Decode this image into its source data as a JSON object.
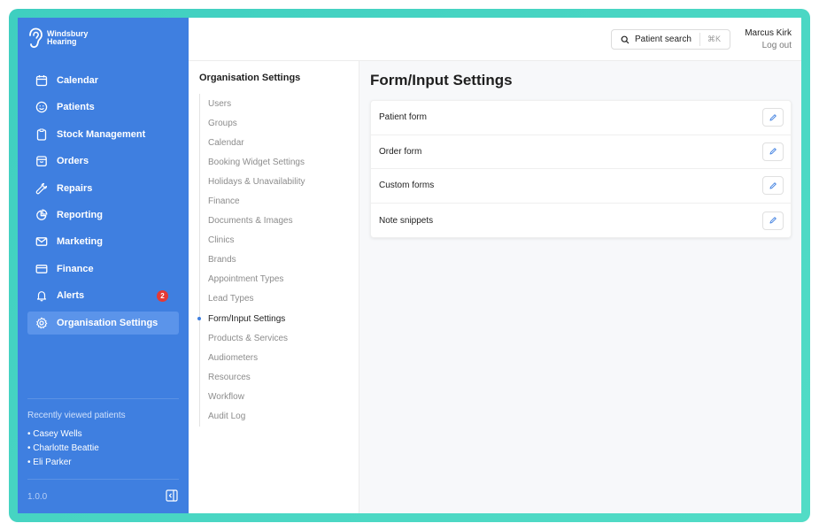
{
  "brand": {
    "line1": "Windsbury",
    "line2": "Hearing"
  },
  "sidebar": {
    "items": [
      {
        "label": "Calendar",
        "icon": "calendar-icon"
      },
      {
        "label": "Patients",
        "icon": "smile-icon"
      },
      {
        "label": "Stock Management",
        "icon": "clipboard-icon"
      },
      {
        "label": "Orders",
        "icon": "box-icon"
      },
      {
        "label": "Repairs",
        "icon": "wrench-icon"
      },
      {
        "label": "Reporting",
        "icon": "pie-chart-icon"
      },
      {
        "label": "Marketing",
        "icon": "mail-icon"
      },
      {
        "label": "Finance",
        "icon": "credit-card-icon"
      },
      {
        "label": "Alerts",
        "icon": "bell-icon",
        "badge": "2"
      },
      {
        "label": "Organisation Settings",
        "icon": "gear-icon",
        "active": true
      }
    ],
    "recent_title": "Recently viewed patients",
    "recent": [
      "• Casey Wells",
      "• Charlotte Beattie",
      "• Eli Parker"
    ],
    "version": "1.0.0"
  },
  "topbar": {
    "search_label": "Patient search",
    "search_shortcut": "⌘K",
    "user_name": "Marcus Kirk",
    "logout": "Log out"
  },
  "subnav": {
    "title": "Organisation Settings",
    "items": [
      "Users",
      "Groups",
      "Calendar",
      "Booking Widget Settings",
      "Holidays & Unavailability",
      "Finance",
      "Documents & Images",
      "Clinics",
      "Brands",
      "Appointment Types",
      "Lead Types",
      "Form/Input Settings",
      "Products & Services",
      "Audiometers",
      "Resources",
      "Workflow",
      "Audit Log"
    ],
    "active": "Form/Input Settings"
  },
  "main": {
    "title": "Form/Input Settings",
    "rows": [
      "Patient form",
      "Order form",
      "Custom forms",
      "Note snippets"
    ]
  },
  "colors": {
    "sidebar": "#3f7fe0",
    "accent": "#3f7fe0",
    "badge": "#e53935",
    "frame": "#3fcfc0"
  }
}
